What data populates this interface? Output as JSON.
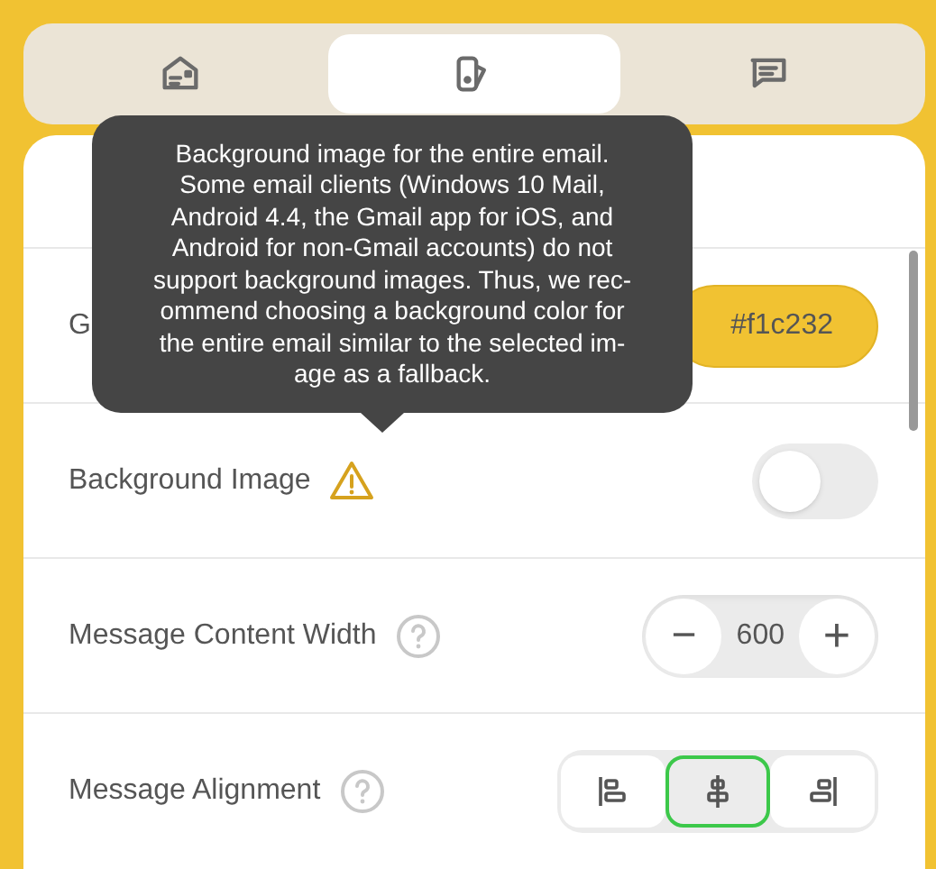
{
  "tabs": [
    {
      "selected": false
    },
    {
      "selected": true
    },
    {
      "selected": false
    }
  ],
  "tooltip": "Background image for the entire email.\nSome email clients (Windows 10 Mail,\nAndroid 4.4, the Gmail app for iOS, and\nAndroid for non-Gmail accounts) do not\nsupport background images. Thus, we rec-\nommend choosing a background color for\nthe entire email similar to the selected im-\nage as a fallback.",
  "rows": [
    {
      "kind": "color",
      "label": "G",
      "value": "#f1c232"
    },
    {
      "kind": "toggle",
      "label": "Background Image",
      "on": false
    },
    {
      "kind": "stepper",
      "label": "Message Content Width",
      "value": "600",
      "minus": "−",
      "plus": "+"
    },
    {
      "kind": "align",
      "label": "Message Alignment",
      "options": [
        {
          "selected": false
        },
        {
          "selected": true
        },
        {
          "selected": false
        }
      ]
    }
  ]
}
